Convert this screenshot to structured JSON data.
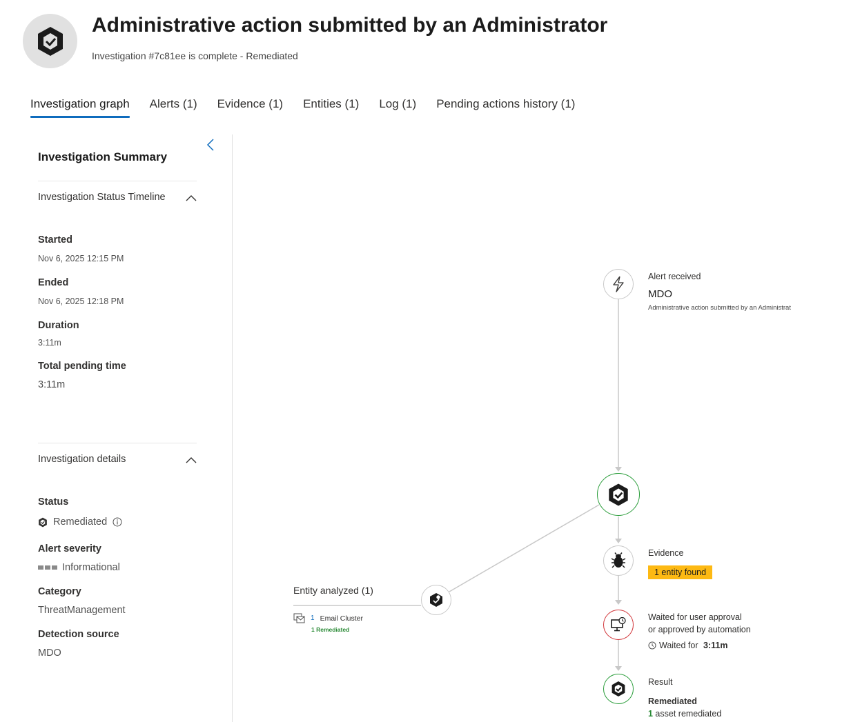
{
  "header": {
    "title": "Administrative action submitted by an Administrator",
    "subtitle": "Investigation #7c81ee is complete - Remediated"
  },
  "tabs": [
    {
      "label": "Investigation graph",
      "active": true
    },
    {
      "label": "Alerts (1)"
    },
    {
      "label": "Evidence (1)"
    },
    {
      "label": "Entities (1)"
    },
    {
      "label": "Log (1)"
    },
    {
      "label": "Pending actions history (1)"
    }
  ],
  "summary": {
    "title": "Investigation Summary",
    "timeline": {
      "heading": "Investigation Status Timeline",
      "started_label": "Started",
      "started_value": "Nov 6, 2025 12:15 PM",
      "ended_label": "Ended",
      "ended_value": "Nov 6, 2025 12:18 PM",
      "duration_label": "Duration",
      "duration_value": "3:11m",
      "pending_label": "Total pending time",
      "pending_value": "3:11m"
    },
    "details": {
      "heading": "Investigation details",
      "status_label": "Status",
      "status_value": "Remediated",
      "severity_label": "Alert severity",
      "severity_value": "Informational",
      "category_label": "Category",
      "category_value": "ThreatManagement",
      "source_label": "Detection source",
      "source_value": "MDO"
    }
  },
  "graph": {
    "alert": {
      "label": "Alert received",
      "source": "MDO",
      "description": "Administrative action submitted by an Administrat"
    },
    "evidence": {
      "label": "Evidence",
      "badge": "1 entity found"
    },
    "approval": {
      "line1": "Waited for user approval",
      "line2": "or approved by automation",
      "waited_prefix": "Waited for ",
      "waited_value": "3:11m"
    },
    "result": {
      "label": "Result",
      "status": "Remediated",
      "count": "1",
      "suffix": " asset remediated"
    },
    "entity": {
      "heading": "Entity analyzed (1)",
      "count": "1",
      "type": "Email Cluster",
      "remediated": "1 Remediated"
    }
  },
  "colors": {
    "accent": "#0f6cbd",
    "success": "#2a9d3a",
    "danger": "#d13438",
    "badge": "#fdb913"
  }
}
